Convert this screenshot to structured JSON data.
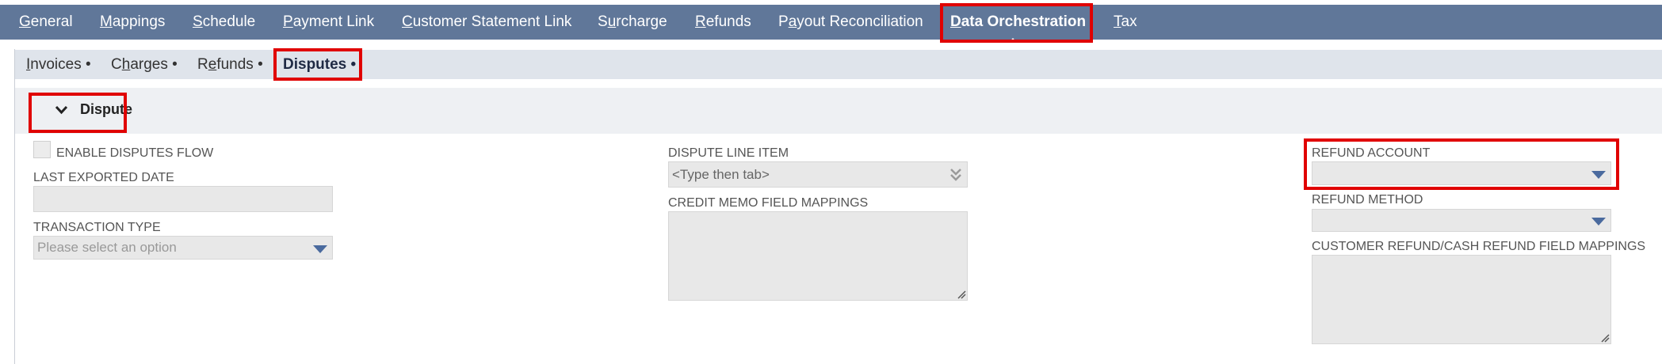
{
  "top_tabs": [
    {
      "label": "General",
      "key": "G",
      "rest": "eneral",
      "active": false
    },
    {
      "label": "Mappings",
      "key": "M",
      "rest": "appings",
      "active": false
    },
    {
      "label": "Schedule",
      "key": "S",
      "rest": "chedule",
      "active": false
    },
    {
      "label": "Payment Link",
      "key": "P",
      "rest": "ayment Link",
      "active": false
    },
    {
      "label": "Customer Statement Link",
      "key": "C",
      "rest": "ustomer Statement Link",
      "active": false
    },
    {
      "label": "Surcharge",
      "pre": "S",
      "key": "u",
      "rest": "rcharge",
      "active": false
    },
    {
      "label": "Refunds",
      "key": "R",
      "rest": "efunds",
      "active": false
    },
    {
      "label": "Payout Reconciliation",
      "pre": "P",
      "key": "a",
      "rest": "yout Reconciliation",
      "active": false
    },
    {
      "label": "Data Orchestration",
      "key": "D",
      "rest": "ata Orchestration",
      "active": true
    },
    {
      "label": "Tax",
      "key": "T",
      "rest": "ax",
      "active": false
    }
  ],
  "sub_tabs": [
    {
      "label": "Invoices",
      "pre": "",
      "key": "I",
      "rest": "nvoices",
      "dot": "•",
      "active": false
    },
    {
      "label": "Charges",
      "pre": "C",
      "key": "h",
      "rest": "arges",
      "dot": "•",
      "active": false
    },
    {
      "label": "Refunds",
      "pre": "R",
      "key": "e",
      "rest": "funds",
      "dot": "•",
      "active": false
    },
    {
      "label": "Disputes",
      "pre": "",
      "key": "",
      "rest": "Disputes",
      "dot": "•",
      "active": true
    }
  ],
  "section": {
    "title": "Dispute"
  },
  "form": {
    "enable_disputes_flow": {
      "label": "ENABLE DISPUTES FLOW",
      "checked": false
    },
    "last_exported_date": {
      "label": "LAST EXPORTED DATE",
      "value": ""
    },
    "transaction_type": {
      "label": "TRANSACTION TYPE",
      "placeholder": "Please select an option"
    },
    "dispute_line_item": {
      "label": "DISPUTE LINE ITEM",
      "placeholder": "<Type then tab>"
    },
    "credit_memo_field_mappings": {
      "label": "CREDIT MEMO FIELD MAPPINGS",
      "value": ""
    },
    "refund_account": {
      "label": "REFUND ACCOUNT",
      "value": ""
    },
    "refund_method": {
      "label": "REFUND METHOD",
      "value": ""
    },
    "customer_refund_field_mappings": {
      "label": "CUSTOMER REFUND/CASH REFUND FIELD MAPPINGS",
      "value": ""
    }
  },
  "colors": {
    "nav_bg": "#607799",
    "subnav_bg": "#dfe4eb",
    "highlight": "#e00000",
    "dropdown_arrow": "#4a6a9e"
  }
}
